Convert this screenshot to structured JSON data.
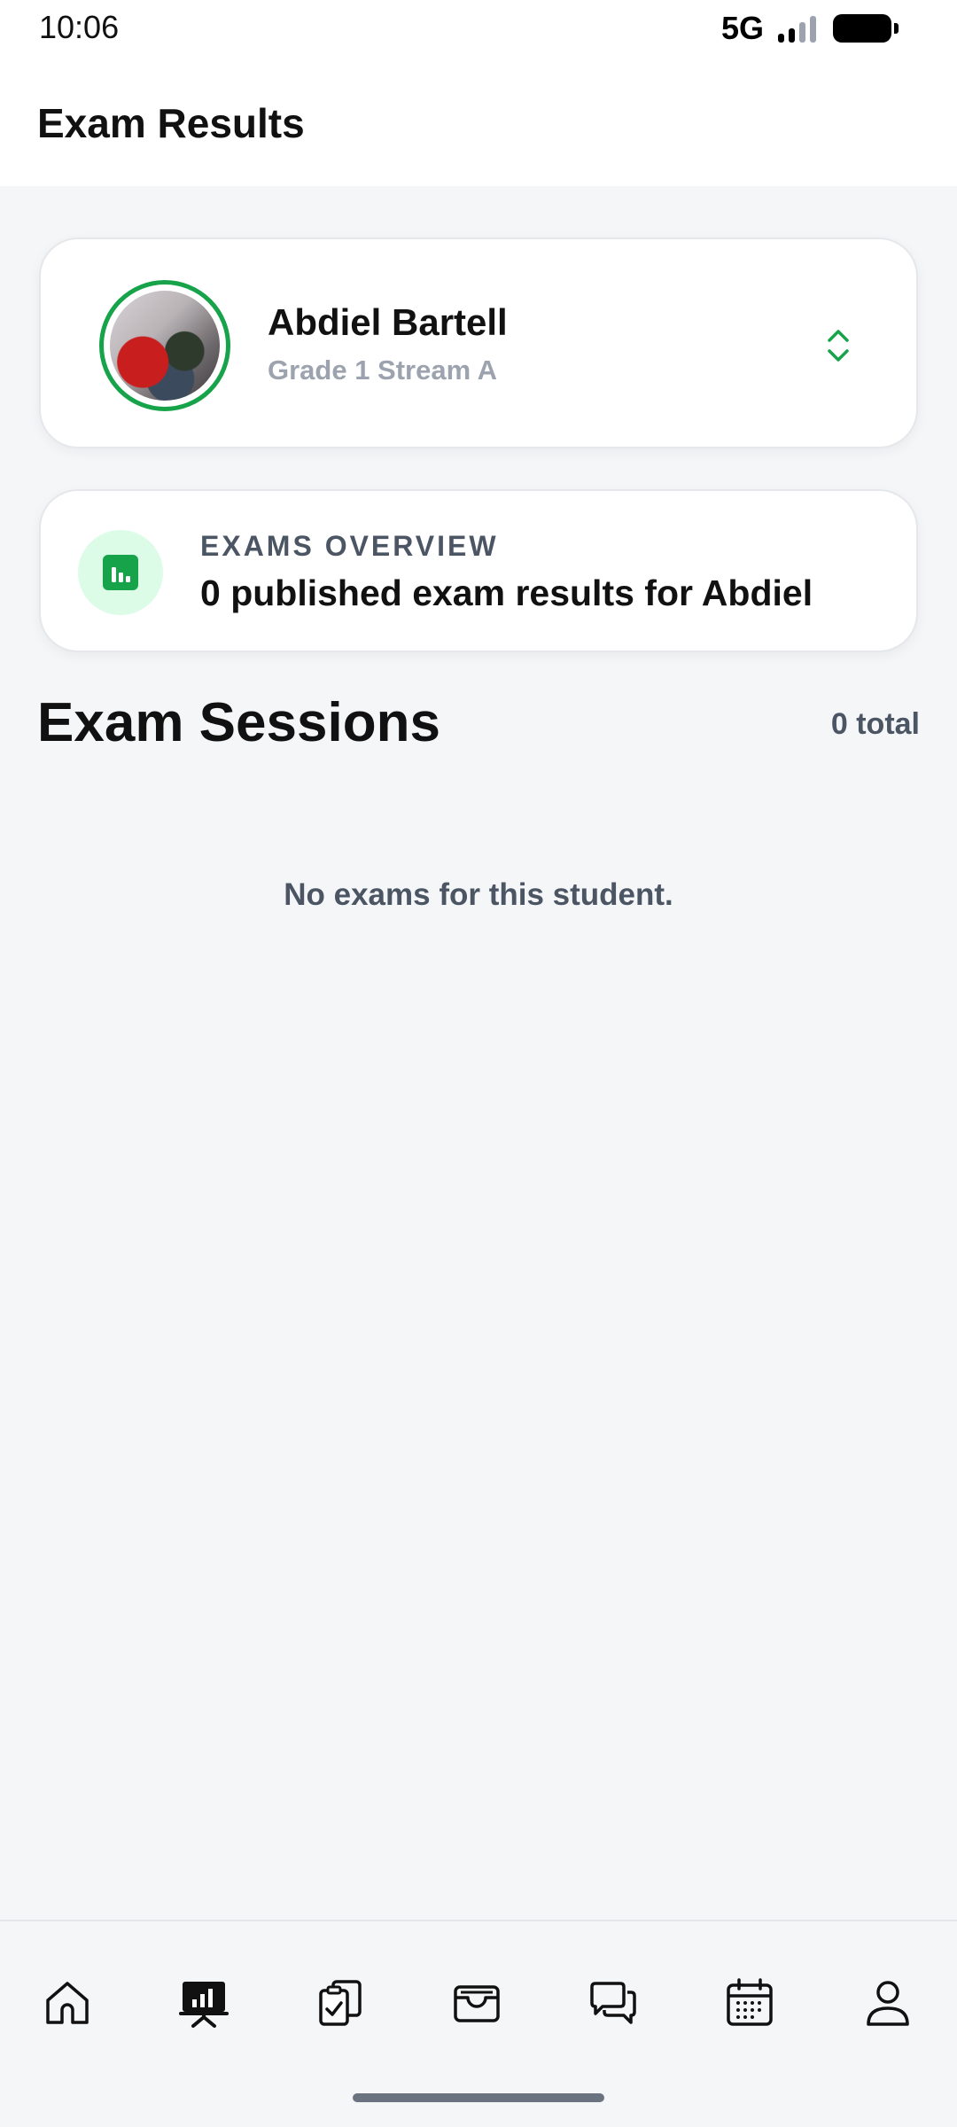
{
  "status_bar": {
    "time": "10:06",
    "network": "5G"
  },
  "header": {
    "title": "Exam Results"
  },
  "student": {
    "name": "Abdiel Bartell",
    "class": "Grade 1 Stream A"
  },
  "overview": {
    "label": "EXAMS OVERVIEW",
    "text": "0 published exam results for Abdiel"
  },
  "sessions": {
    "title": "Exam Sessions",
    "total": "0 total",
    "empty_message": "No exams for this student."
  },
  "bottom_nav": {
    "items": [
      {
        "icon": "home-icon",
        "active": false
      },
      {
        "icon": "presentation-chart-icon",
        "active": true
      },
      {
        "icon": "clipboard-check-icon",
        "active": false
      },
      {
        "icon": "wallet-icon",
        "active": false
      },
      {
        "icon": "chat-bubbles-icon",
        "active": false
      },
      {
        "icon": "calendar-icon",
        "active": false
      },
      {
        "icon": "user-icon",
        "active": false
      }
    ]
  },
  "colors": {
    "accent": "#16a34a",
    "accent_light": "#dcfce7",
    "background": "#f5f6f8",
    "muted_text": "#9ca3af"
  }
}
